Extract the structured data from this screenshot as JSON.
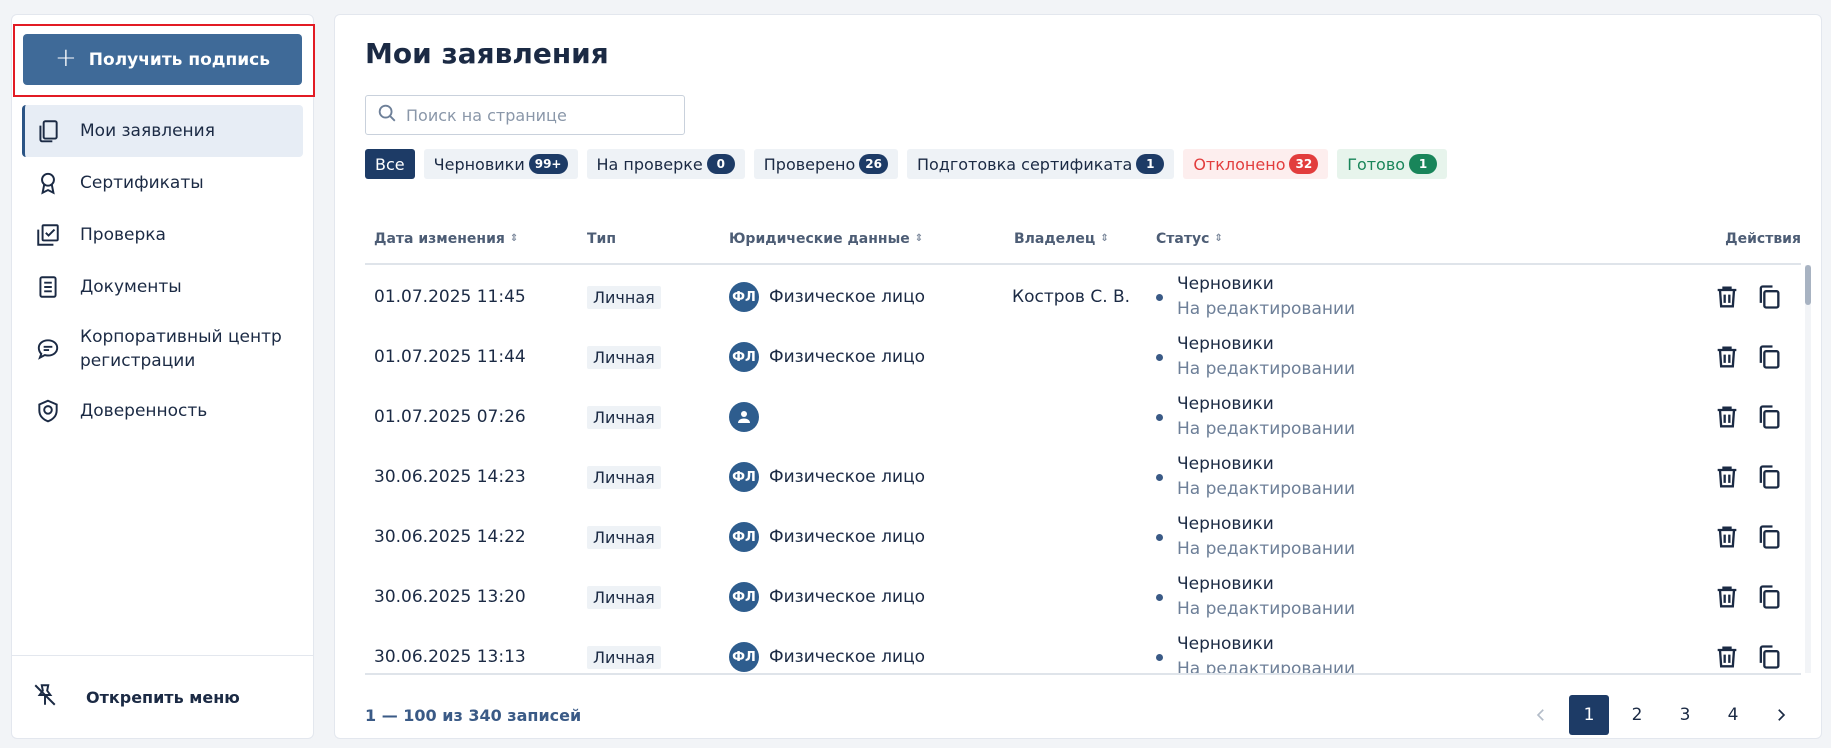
{
  "sidebar": {
    "get_signature_label": "Получить подпись",
    "items": [
      {
        "label": "Мои заявления",
        "icon": "documents-stack-icon"
      },
      {
        "label": "Сертификаты",
        "icon": "certificate-icon"
      },
      {
        "label": "Проверка",
        "icon": "checkbox-icon"
      },
      {
        "label": "Документы",
        "icon": "document-icon"
      },
      {
        "label": "Корпоративный центр регистрации",
        "icon": "chat-icon"
      },
      {
        "label": "Доверенность",
        "icon": "shield-icon"
      }
    ],
    "unpin_label": "Открепить меню"
  },
  "main": {
    "title": "Мои заявления",
    "search_placeholder": "Поиск на странице",
    "filters": [
      {
        "label": "Все",
        "count": ""
      },
      {
        "label": "Черновики",
        "count": "99+"
      },
      {
        "label": "На проверке",
        "count": "0"
      },
      {
        "label": "Проверено",
        "count": "26"
      },
      {
        "label": "Подготовка сертификата",
        "count": "1"
      },
      {
        "label": "Отклонено",
        "count": "32"
      },
      {
        "label": "Готово",
        "count": "1"
      }
    ],
    "columns": {
      "date": "Дата изменения",
      "type": "Тип",
      "legal": "Юридические данные",
      "owner": "Владелец",
      "status": "Статус",
      "actions": "Действия"
    },
    "rows": [
      {
        "date": "01.07.2025 11:45",
        "type": "Личная",
        "avatar": "ФЛ",
        "legal": "Физическое лицо",
        "owner": "Костров С. В.",
        "status": "Черновики",
        "substatus": "На редактировании"
      },
      {
        "date": "01.07.2025 11:44",
        "type": "Личная",
        "avatar": "ФЛ",
        "legal": "Физическое лицо",
        "owner": "",
        "status": "Черновики",
        "substatus": "На редактировании"
      },
      {
        "date": "01.07.2025 07:26",
        "type": "Личная",
        "avatar": "",
        "legal": "",
        "owner": "",
        "status": "Черновики",
        "substatus": "На редактировании"
      },
      {
        "date": "30.06.2025 14:23",
        "type": "Личная",
        "avatar": "ФЛ",
        "legal": "Физическое лицо",
        "owner": "",
        "status": "Черновики",
        "substatus": "На редактировании"
      },
      {
        "date": "30.06.2025 14:22",
        "type": "Личная",
        "avatar": "ФЛ",
        "legal": "Физическое лицо",
        "owner": "",
        "status": "Черновики",
        "substatus": "На редактировании"
      },
      {
        "date": "30.06.2025 13:20",
        "type": "Личная",
        "avatar": "ФЛ",
        "legal": "Физическое лицо",
        "owner": "",
        "status": "Черновики",
        "substatus": "На редактировании"
      },
      {
        "date": "30.06.2025 13:13",
        "type": "Личная",
        "avatar": "ФЛ",
        "legal": "Физическое лицо",
        "owner": "",
        "status": "Черновики",
        "substatus": "На редактировании"
      }
    ],
    "records_label": "1 — 100 из 340 записей",
    "pages": [
      "1",
      "2",
      "3",
      "4"
    ],
    "current_page": "1"
  },
  "colors": {
    "primary": "#1d3b66",
    "button": "#3f6a98",
    "danger": "#e23d3d",
    "success": "#19855a",
    "highlight": "#e21b24"
  }
}
